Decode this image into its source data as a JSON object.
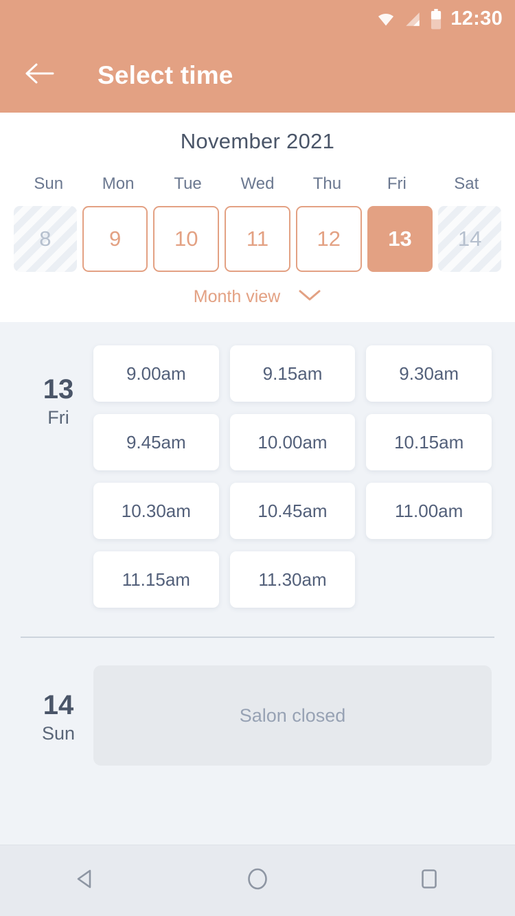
{
  "theme": {
    "accent": "#E3A183",
    "background": "#F0F3F7",
    "panel": "#FFFFFF",
    "text_dark": "#4A5568",
    "text_muted": "#97A2B4",
    "disabled_cell": "#EBEFF4"
  },
  "statusbar": {
    "time": "12:30",
    "icons": [
      "wifi-icon",
      "cellular-signal-icon",
      "battery-icon"
    ]
  },
  "appbar": {
    "back_icon": "back-arrow-icon",
    "title": "Select time"
  },
  "calendar": {
    "month_title": "November 2021",
    "weekdays": [
      "Sun",
      "Mon",
      "Tue",
      "Wed",
      "Thu",
      "Fri",
      "Sat"
    ],
    "dates": [
      {
        "day": "8",
        "state": "disabled"
      },
      {
        "day": "9",
        "state": "available"
      },
      {
        "day": "10",
        "state": "available"
      },
      {
        "day": "11",
        "state": "available"
      },
      {
        "day": "12",
        "state": "available"
      },
      {
        "day": "13",
        "state": "selected"
      },
      {
        "day": "14",
        "state": "disabled"
      }
    ],
    "month_view_label": "Month view",
    "month_view_icon": "chevron-down-icon"
  },
  "schedule": [
    {
      "date_number": "13",
      "weekday": "Fri",
      "slots": [
        "9.00am",
        "9.15am",
        "9.30am",
        "9.45am",
        "10.00am",
        "10.15am",
        "10.30am",
        "10.45am",
        "11.00am",
        "11.15am",
        "11.30am"
      ]
    },
    {
      "date_number": "14",
      "weekday": "Sun",
      "closed_message": "Salon closed"
    }
  ],
  "navbar": {
    "back_label": "back-triangle-icon",
    "home_label": "home-circle-icon",
    "recents_label": "recents-square-icon"
  }
}
